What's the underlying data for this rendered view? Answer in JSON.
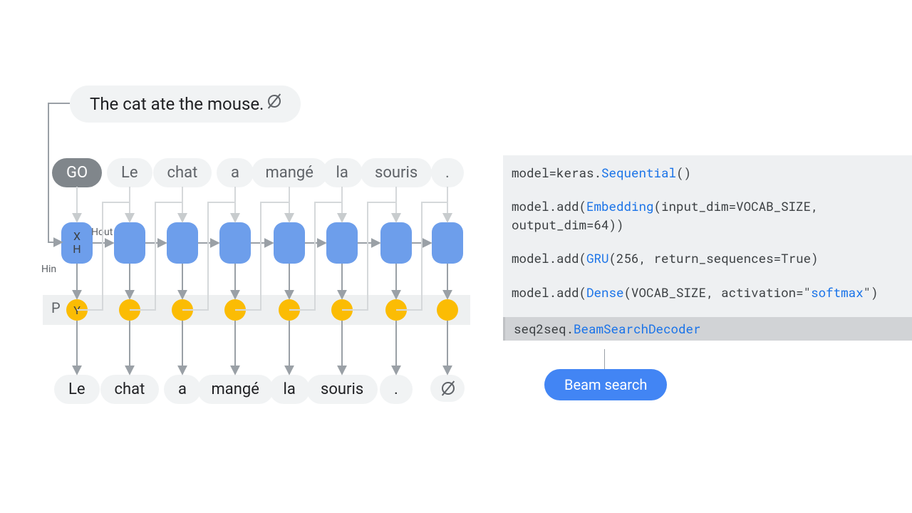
{
  "diagram": {
    "input_sentence": "The cat ate the mouse.",
    "go_token": "GO",
    "decoder_inputs": [
      "Le",
      "chat",
      "a",
      "mangé",
      "la",
      "souris",
      "."
    ],
    "outputs": [
      "Le",
      "chat",
      "a",
      "mangé",
      "la",
      "souris",
      ".",
      "∅"
    ],
    "labels": {
      "X": "X",
      "H": "H",
      "Y": "Y",
      "P": "P",
      "Hin": "Hin",
      "Hout": "Hout"
    }
  },
  "code": {
    "lines": [
      {
        "segments": [
          {
            "t": "model=keras."
          },
          {
            "t": "Sequential",
            "cls": "kw-blue"
          },
          {
            "t": "()"
          }
        ]
      },
      {
        "segments": [
          {
            "t": "model.add("
          },
          {
            "t": "Embedding",
            "cls": "kw-blue"
          },
          {
            "t": "(input_dim=VOCAB_SIZE, output_dim=64))"
          }
        ]
      },
      {
        "segments": [
          {
            "t": "model.add("
          },
          {
            "t": "GRU",
            "cls": "kw-blue"
          },
          {
            "t": "(256, return_sequences=True)"
          }
        ]
      },
      {
        "segments": [
          {
            "t": "model.add("
          },
          {
            "t": "Dense",
            "cls": "kw-blue"
          },
          {
            "t": "(VOCAB_SIZE, activation=\""
          },
          {
            "t": "softmax",
            "cls": "kw-str"
          },
          {
            "t": "\")"
          }
        ]
      },
      {
        "hl": true,
        "segments": [
          {
            "t": "seq2seq."
          },
          {
            "t": "BeamSearchDecoder",
            "cls": "kw-blue"
          }
        ]
      }
    ],
    "beam_button": "Beam search"
  },
  "colors": {
    "gru": "#6d9eeb",
    "output": "#fbbc04",
    "code_bg": "#eef0f2",
    "accent": "#4285f4",
    "pill_bg": "#f1f3f4",
    "text_muted": "#5f6368"
  }
}
